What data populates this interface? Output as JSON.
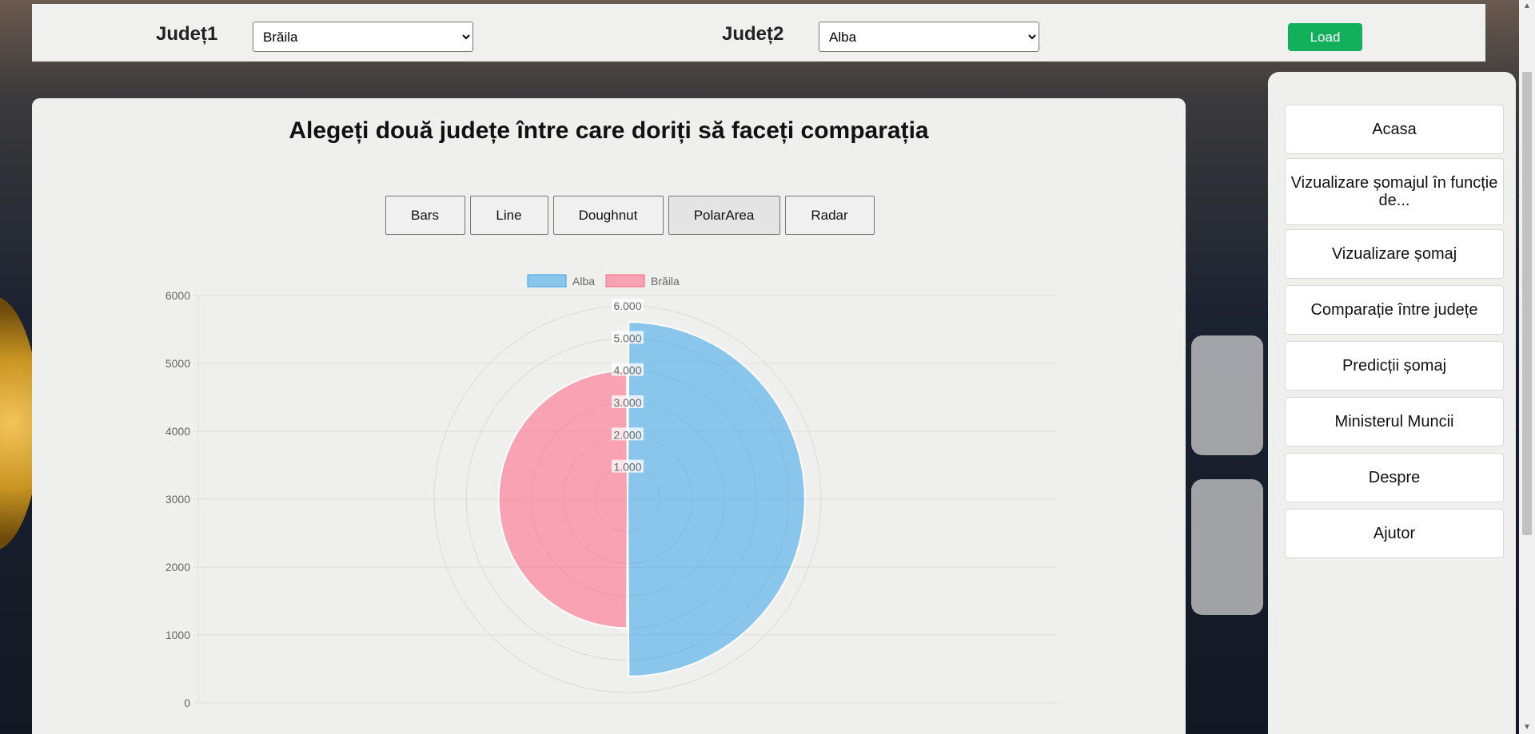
{
  "topbar": {
    "county1_label": "Județ1",
    "county1_value": "Brăila",
    "county2_label": "Județ2",
    "county2_value": "Alba",
    "load_label": "Load"
  },
  "main": {
    "title": "Alegeți două județe între care doriți să faceți comparația",
    "chart_buttons": [
      "Bars",
      "Line",
      "Doughnut",
      "PolarArea",
      "Radar"
    ],
    "active_chart_button": "PolarArea"
  },
  "sidebar": {
    "items": [
      "Acasa",
      "Vizualizare șomajul în funcție de...",
      "Vizualizare șomaj",
      "Comparație între județe",
      "Predicții șomaj",
      "Ministerul Muncii",
      "Despre",
      "Ajutor"
    ]
  },
  "chart_data": {
    "type": "polarArea",
    "series": [
      {
        "name": "Alba",
        "value": 5500,
        "color": "#36a2eb"
      },
      {
        "name": "Brăila",
        "value": 4000,
        "color": "#ff6384"
      }
    ],
    "legend_position": "top",
    "cartesian_y_ticks": [
      "0",
      "1000",
      "2000",
      "3000",
      "4000",
      "5000",
      "6000"
    ],
    "radial_ticks": [
      "1.000",
      "2.000",
      "3.000",
      "4.000",
      "5.000",
      "6.000"
    ],
    "radial_max": 6000,
    "grid": true
  }
}
